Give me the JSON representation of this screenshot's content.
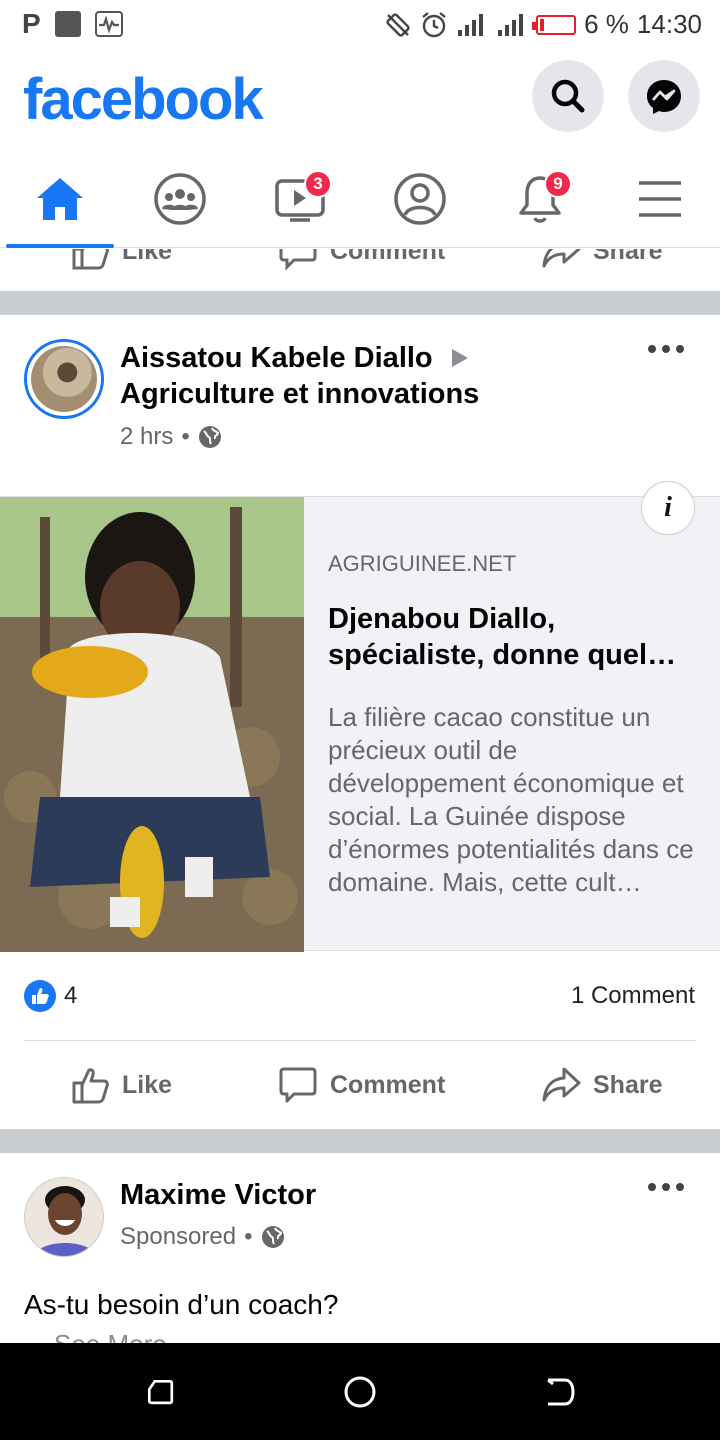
{
  "status_bar": {
    "left_glyph": "P",
    "battery_text": "6 %",
    "time": "14:30"
  },
  "header": {
    "logo": "facebook",
    "search_icon": "search-icon",
    "messenger_icon": "messenger-icon"
  },
  "nav": {
    "tabs": [
      {
        "name": "home",
        "icon": "home-icon",
        "active": true
      },
      {
        "name": "groups",
        "icon": "groups-icon"
      },
      {
        "name": "watch",
        "icon": "video-icon",
        "badge": "3"
      },
      {
        "name": "profile",
        "icon": "profile-icon"
      },
      {
        "name": "notifications",
        "icon": "bell-icon",
        "badge": "9"
      },
      {
        "name": "menu",
        "icon": "hamburger-icon"
      }
    ]
  },
  "prev_post_actions": {
    "like": "Like",
    "comment": "Comment",
    "share": "Share"
  },
  "post": {
    "author": "Aissatou Kabele Diallo",
    "group": "Agriculture et innovations",
    "time": "2 hrs",
    "link": {
      "source": "AGRIGUINEE.NET",
      "title": "Djenabou Diallo, spécialiste, donne quel…",
      "description": "La filière cacao constitue un précieux outil de développement économique et social. La Guinée dispose d’énormes potentialités dans ce domaine. Mais, cette cult…",
      "info_label": "i"
    },
    "reactions": {
      "like_count": "4",
      "comments": "1 Comment"
    },
    "actions": {
      "like": "Like",
      "comment": "Comment",
      "share": "Share"
    }
  },
  "post2": {
    "author": "Maxime Victor",
    "meta": "Sponsored",
    "text": "As-tu besoin d’un coach?",
    "see_more": "See More"
  },
  "colors": {
    "brand": "#1877f2",
    "badge": "#f02849",
    "divider": "#c9ccd1",
    "secondary_text": "#65676b"
  }
}
